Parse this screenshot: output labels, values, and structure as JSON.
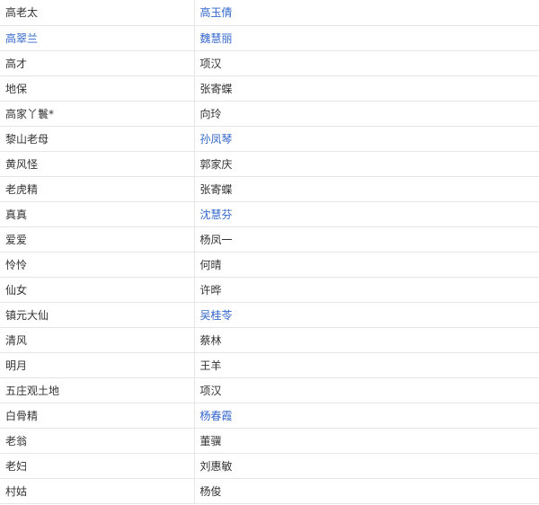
{
  "colors": {
    "text": "#333333",
    "link": "#3366cc",
    "border": "#e6e6e6"
  },
  "rows": [
    {
      "role": "高老太",
      "role_link": false,
      "actor": "高玉倩",
      "actor_link": true
    },
    {
      "role": "高翠兰",
      "role_link": true,
      "actor": "魏慧丽",
      "actor_link": true
    },
    {
      "role": "高才",
      "role_link": false,
      "actor": "项汉",
      "actor_link": false
    },
    {
      "role": "地保",
      "role_link": false,
      "actor": "张寄蝶",
      "actor_link": false
    },
    {
      "role": "高家丫鬟*",
      "role_link": false,
      "actor": "向玲",
      "actor_link": false
    },
    {
      "role": "黎山老母",
      "role_link": false,
      "actor": "孙凤琴",
      "actor_link": true
    },
    {
      "role": "黄风怪",
      "role_link": false,
      "actor": "郭家庆",
      "actor_link": false
    },
    {
      "role": "老虎精",
      "role_link": false,
      "actor": "张寄蝶",
      "actor_link": false
    },
    {
      "role": "真真",
      "role_link": false,
      "actor": "沈慧芬",
      "actor_link": true
    },
    {
      "role": "爱爱",
      "role_link": false,
      "actor": "杨凤一",
      "actor_link": false
    },
    {
      "role": "怜怜",
      "role_link": false,
      "actor": "何晴",
      "actor_link": false
    },
    {
      "role": "仙女",
      "role_link": false,
      "actor": "许晔",
      "actor_link": false
    },
    {
      "role": "镇元大仙",
      "role_link": false,
      "actor": "吴桂苓",
      "actor_link": true
    },
    {
      "role": "清风",
      "role_link": false,
      "actor": "蔡林",
      "actor_link": false
    },
    {
      "role": "明月",
      "role_link": false,
      "actor": "王羊",
      "actor_link": false
    },
    {
      "role": "五庄观土地",
      "role_link": false,
      "actor": "项汉",
      "actor_link": false
    },
    {
      "role": "白骨精",
      "role_link": false,
      "actor": "杨春霞",
      "actor_link": true
    },
    {
      "role": "老翁",
      "role_link": false,
      "actor": "董骥",
      "actor_link": false
    },
    {
      "role": "老妇",
      "role_link": false,
      "actor": "刘惠敏",
      "actor_link": false
    },
    {
      "role": "村姑",
      "role_link": false,
      "actor": "杨俊",
      "actor_link": false
    }
  ]
}
